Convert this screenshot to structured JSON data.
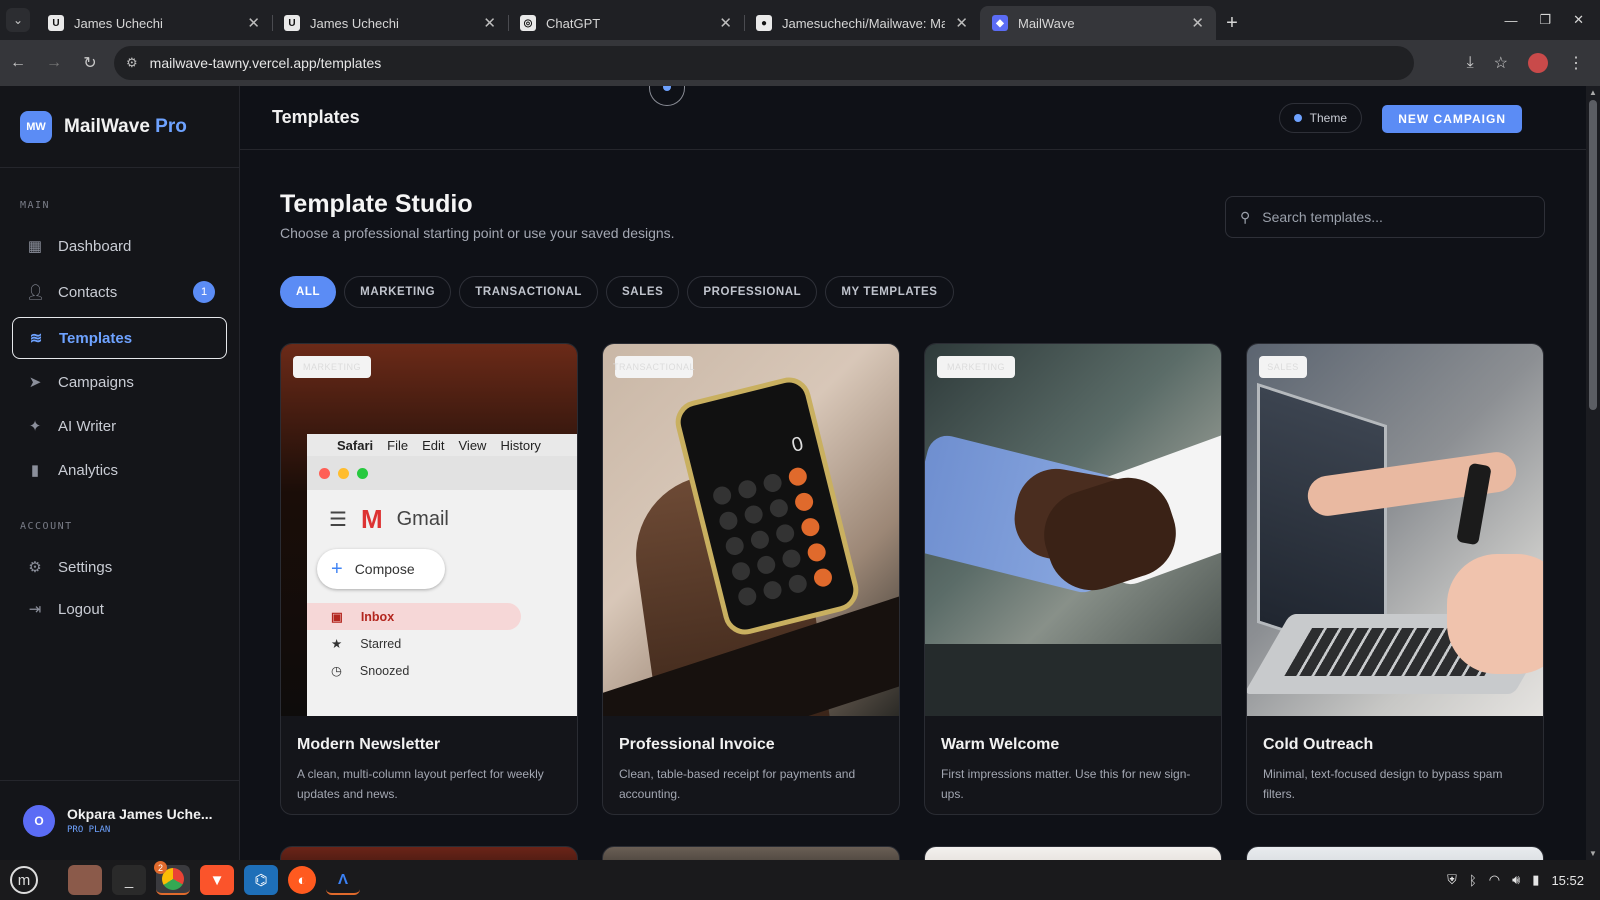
{
  "browser": {
    "tabs": [
      {
        "title": "James Uchechi",
        "icon": "U"
      },
      {
        "title": "James Uchechi",
        "icon": "U"
      },
      {
        "title": "ChatGPT",
        "icon": "◎"
      },
      {
        "title": "Jamesuchechi/Mailwave: Ma",
        "icon": "●"
      },
      {
        "title": "MailWave",
        "icon": "◆"
      }
    ],
    "active_tab": 4,
    "url": "mailwave-tawny.vercel.app/templates"
  },
  "sidebar": {
    "logo": "MW",
    "brand": "MailWave",
    "brand_suffix": "Pro",
    "section_main": "MAIN",
    "section_account": "ACCOUNT",
    "items": [
      {
        "label": "Dashboard",
        "icon": "dashboard-icon"
      },
      {
        "label": "Contacts",
        "icon": "contacts-icon",
        "badge": "1"
      },
      {
        "label": "Templates",
        "icon": "layers-icon"
      },
      {
        "label": "Campaigns",
        "icon": "send-icon"
      },
      {
        "label": "AI Writer",
        "icon": "sparkles-icon"
      },
      {
        "label": "Analytics",
        "icon": "bar-chart-icon"
      }
    ],
    "account_items": [
      {
        "label": "Settings",
        "icon": "gear-icon"
      },
      {
        "label": "Logout",
        "icon": "logout-icon"
      }
    ],
    "user": {
      "initial": "O",
      "name": "Okpara James Uche...",
      "plan": "PRO PLAN"
    }
  },
  "header": {
    "title": "Templates",
    "theme_label": "Theme",
    "new_campaign": "NEW CAMPAIGN"
  },
  "studio": {
    "title": "Template Studio",
    "subtitle": "Choose a professional starting point or use your saved designs.",
    "search_placeholder": "Search templates...",
    "filters": [
      "ALL",
      "MARKETING",
      "TRANSACTIONAL",
      "SALES",
      "PROFESSIONAL",
      "MY TEMPLATES"
    ],
    "active_filter": 0
  },
  "templates": [
    {
      "title": "Modern Newsletter",
      "description": "A clean, multi-column layout perfect for weekly updates and news.",
      "tag": "MARKETING"
    },
    {
      "title": "Professional Invoice",
      "description": "Clean, table-based receipt for payments and accounting.",
      "tag": "TRANSACTIONAL"
    },
    {
      "title": "Warm Welcome",
      "description": "First impressions matter. Use this for new sign-ups.",
      "tag": "MARKETING"
    },
    {
      "title": "Cold Outreach",
      "description": "Minimal, text-focused design to bypass spam filters.",
      "tag": "SALES"
    }
  ],
  "gmail_preview": {
    "menu": [
      "Safari",
      "File",
      "Edit",
      "View",
      "History"
    ],
    "app": "Gmail",
    "compose": "Compose",
    "items": [
      "Inbox",
      "Starred",
      "Snoozed"
    ]
  },
  "calculator_preview": {
    "display": "0"
  },
  "taskbar": {
    "time": "15:52",
    "chrome_badge": "2"
  },
  "colors": {
    "accent": "#5b8cf5",
    "background": "#0f1117",
    "sidebar": "#141519"
  }
}
